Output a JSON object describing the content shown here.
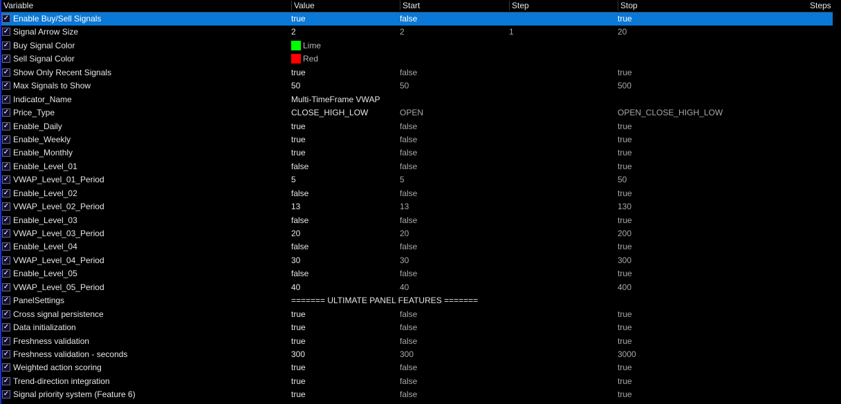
{
  "columns": {
    "variable": "Variable",
    "value": "Value",
    "start": "Start",
    "step": "Step",
    "stop": "Stop",
    "steps": "Steps"
  },
  "colors": {
    "selection": "#0a78d7",
    "lime": "#00ff00",
    "red": "#ff0000",
    "edge": "#1c2fd6"
  },
  "rows": [
    {
      "variable": "Enable Buy/Sell Signals",
      "value": "true",
      "start": "false",
      "step": "",
      "stop": "true",
      "selected": true
    },
    {
      "variable": "Signal Arrow Size",
      "value": "2",
      "start": "2",
      "step": "1",
      "stop": "20"
    },
    {
      "variable": "Buy Signal Color",
      "value": "Lime",
      "swatch": "#00ff00",
      "start": "",
      "step": "",
      "stop": ""
    },
    {
      "variable": "Sell Signal Color",
      "value": "Red",
      "swatch": "#ff0000",
      "start": "",
      "step": "",
      "stop": ""
    },
    {
      "variable": "Show Only Recent Signals",
      "value": "true",
      "start": "false",
      "step": "",
      "stop": "true"
    },
    {
      "variable": "Max Signals to Show",
      "value": "50",
      "start": "50",
      "step": "",
      "stop": "500"
    },
    {
      "variable": "Indicator_Name",
      "value": "Multi-TimeFrame VWAP",
      "start": "",
      "step": "",
      "stop": ""
    },
    {
      "variable": "Price_Type",
      "value": "CLOSE_HIGH_LOW",
      "start": "OPEN",
      "step": "",
      "stop": "OPEN_CLOSE_HIGH_LOW"
    },
    {
      "variable": "Enable_Daily",
      "value": "true",
      "start": "false",
      "step": "",
      "stop": "true"
    },
    {
      "variable": "Enable_Weekly",
      "value": "true",
      "start": "false",
      "step": "",
      "stop": "true"
    },
    {
      "variable": "Enable_Monthly",
      "value": "true",
      "start": "false",
      "step": "",
      "stop": "true"
    },
    {
      "variable": "Enable_Level_01",
      "value": "false",
      "start": "false",
      "step": "",
      "stop": "true"
    },
    {
      "variable": "VWAP_Level_01_Period",
      "value": "5",
      "start": "5",
      "step": "",
      "stop": "50"
    },
    {
      "variable": "Enable_Level_02",
      "value": "false",
      "start": "false",
      "step": "",
      "stop": "true"
    },
    {
      "variable": "VWAP_Level_02_Period",
      "value": "13",
      "start": "13",
      "step": "",
      "stop": "130"
    },
    {
      "variable": "Enable_Level_03",
      "value": "false",
      "start": "false",
      "step": "",
      "stop": "true"
    },
    {
      "variable": "VWAP_Level_03_Period",
      "value": "20",
      "start": "20",
      "step": "",
      "stop": "200"
    },
    {
      "variable": "Enable_Level_04",
      "value": "false",
      "start": "false",
      "step": "",
      "stop": "true"
    },
    {
      "variable": "VWAP_Level_04_Period",
      "value": "30",
      "start": "30",
      "step": "",
      "stop": "300"
    },
    {
      "variable": "Enable_Level_05",
      "value": "false",
      "start": "false",
      "step": "",
      "stop": "true"
    },
    {
      "variable": "VWAP_Level_05_Period",
      "value": "40",
      "start": "40",
      "step": "",
      "stop": "400"
    },
    {
      "variable": "PanelSettings",
      "value": "======= ULTIMATE PANEL FEATURES =======",
      "start": "",
      "step": "",
      "stop": ""
    },
    {
      "variable": "Cross signal persistence",
      "value": "true",
      "start": "false",
      "step": "",
      "stop": "true"
    },
    {
      "variable": "Data initialization",
      "value": "true",
      "start": "false",
      "step": "",
      "stop": "true"
    },
    {
      "variable": "Freshness validation",
      "value": "true",
      "start": "false",
      "step": "",
      "stop": "true"
    },
    {
      "variable": "Freshness validation - seconds",
      "value": "300",
      "start": "300",
      "step": "",
      "stop": "3000"
    },
    {
      "variable": "Weighted action scoring",
      "value": "true",
      "start": "false",
      "step": "",
      "stop": "true"
    },
    {
      "variable": "Trend-direction integration",
      "value": "true",
      "start": "false",
      "step": "",
      "stop": "true"
    },
    {
      "variable": "Signal priority system (Feature 6)",
      "value": "true",
      "start": "false",
      "step": "",
      "stop": "true"
    }
  ]
}
